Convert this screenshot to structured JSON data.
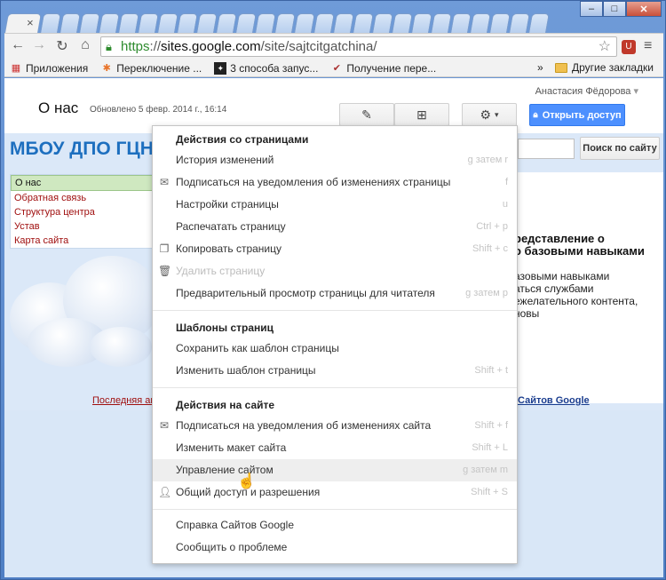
{
  "browser": {
    "url_scheme": "https",
    "url_host": "sites.google.com",
    "url_path": "/site/sajtcitgatchina/",
    "bookmarks": [
      {
        "label": "Приложения",
        "icon": "apps-grid-icon"
      },
      {
        "label": "Переключение ...",
        "icon": "joomla-icon"
      },
      {
        "label": "3 способа запус...",
        "icon": "page-icon"
      },
      {
        "label": "Получение пере...",
        "icon": "bookmark-icon"
      }
    ],
    "bookmarks_more": "»",
    "other_bookmarks": "Другие закладки"
  },
  "header": {
    "user_name": "Анастасия Фёдорова",
    "page_title": "О нас",
    "updated": "Обновлено 5 февр. 2014 г., 16:14",
    "share_label": "Открыть доступ"
  },
  "site": {
    "title": "МБОУ ДПО ГЦН",
    "search_button": "Поиск по сайту",
    "nav": [
      "О нас",
      "Обратная связь",
      "Структура центра",
      "Устав",
      "Карта сайта"
    ],
    "content_heading": [
      "редставление о",
      "о базовыми навыками"
    ],
    "content_body": [
      "азовыми навыками",
      "аться службами",
      "ежелательного контента,",
      "новы"
    ],
    "footer_left": "Последняя акт",
    "footer_right": "Сайтов Google"
  },
  "menu": {
    "section_pages": "Действия со страницами",
    "pages_items": [
      {
        "label": "История изменений",
        "shortcut": "g затем r",
        "icon": ""
      },
      {
        "label": "Подписаться на уведомления об изменениях страницы",
        "shortcut": "f",
        "icon": "mail-icon"
      },
      {
        "label": "Настройки страницы",
        "shortcut": "u",
        "icon": ""
      },
      {
        "label": "Распечатать страницу",
        "shortcut": "Ctrl + p",
        "icon": ""
      },
      {
        "label": "Копировать страницу",
        "shortcut": "Shift + c",
        "icon": "copy-icon"
      },
      {
        "label": "Удалить страницу",
        "shortcut": "",
        "icon": "trash-icon"
      },
      {
        "label": "Предварительный просмотр страницы для читателя",
        "shortcut": "g затем p",
        "icon": ""
      }
    ],
    "section_templates": "Шаблоны страниц",
    "templates_items": [
      {
        "label": "Сохранить как шаблон страницы",
        "shortcut": ""
      },
      {
        "label": "Изменить шаблон страницы",
        "shortcut": "Shift + t"
      }
    ],
    "section_site": "Действия на сайте",
    "site_items": [
      {
        "label": "Подписаться на уведомления об изменениях сайта",
        "shortcut": "Shift + f",
        "icon": "mail-icon"
      },
      {
        "label": "Изменить макет сайта",
        "shortcut": "Shift + L",
        "icon": ""
      },
      {
        "label": "Управление сайтом",
        "shortcut": "g затем m",
        "icon": ""
      },
      {
        "label": "Общий доступ и разрешения",
        "shortcut": "Shift + S",
        "icon": "add-person-icon"
      }
    ],
    "help_items": [
      {
        "label": "Справка Сайтов Google"
      },
      {
        "label": "Сообщить о проблеме"
      }
    ]
  },
  "colors": {
    "site_title": "#1d6fbf",
    "nav_link": "#a01010",
    "share_button": "#4d90fe",
    "page_background": "#dbe8f8"
  }
}
